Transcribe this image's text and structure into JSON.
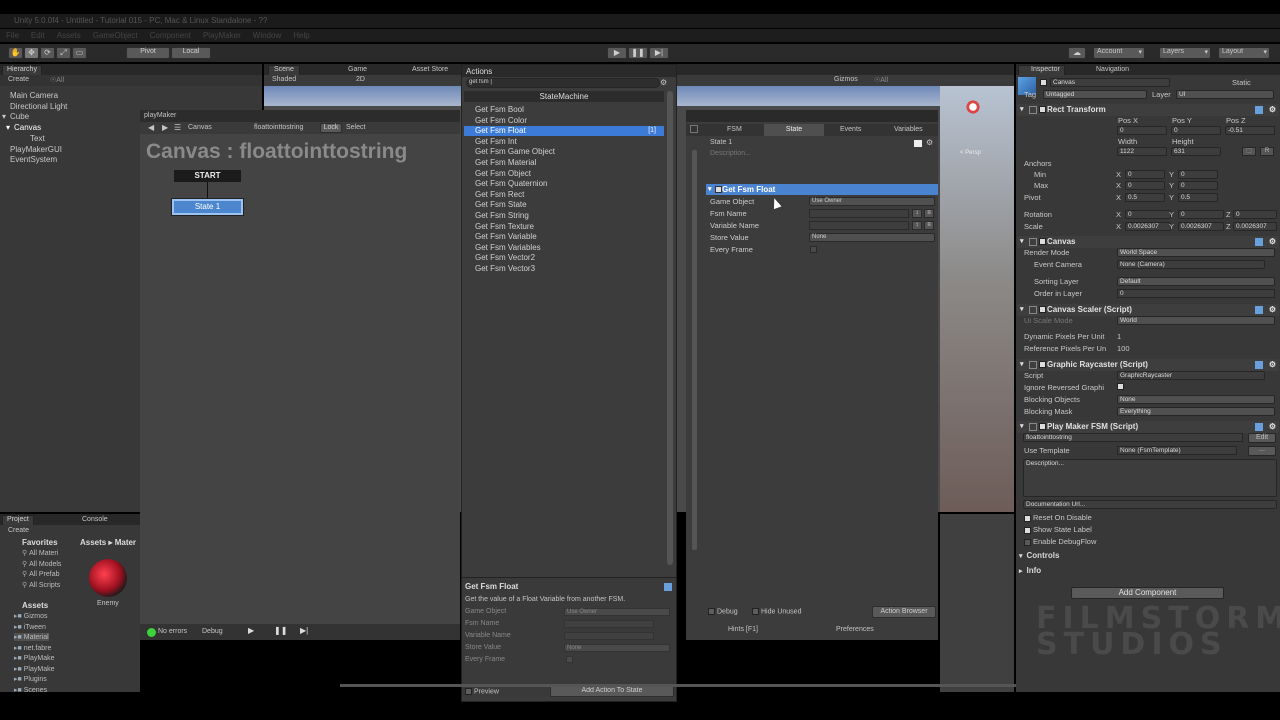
{
  "window_title": "Unity 5.0.0f4 - Untitled - Tutorial 015 - PC, Mac & Linux Standalone - ??",
  "menu": [
    "File",
    "Edit",
    "Assets",
    "GameObject",
    "Component",
    "PlayMaker",
    "Window",
    "Help"
  ],
  "toolbar": {
    "pivot": "Pivot",
    "local": "Local",
    "account": "Account",
    "layers": "Layers",
    "layout": "Layout"
  },
  "hierarchy": {
    "tab": "Hierarchy",
    "create": "Create",
    "search": "☉All",
    "items": [
      "Main Camera",
      "Directional Light",
      "Cube",
      "Canvas",
      "Text",
      "PlayMakerGUI",
      "EventSystem"
    ]
  },
  "scene": {
    "tabs": [
      "Scene",
      "Game",
      "Asset Store"
    ],
    "shaded": "Shaded",
    "mode2d": "2D",
    "gizmos": "Gizmos",
    "search": "☉All",
    "persp": "< Persp"
  },
  "playmaker": {
    "tab": "playMaker",
    "object": "Canvas",
    "fsm": "floattointtostring",
    "lock": "Lock",
    "select": "Select",
    "title": "Canvas : floattointtostring",
    "start": "START",
    "state": "State 1",
    "status": "No errors",
    "debug": "Debug"
  },
  "actions": {
    "title": "Actions",
    "search": "get fsm |",
    "category": "StateMachine",
    "items": [
      "Get Fsm Bool",
      "Get Fsm Color",
      "Get Fsm Float",
      "Get Fsm Int",
      "Get Fsm Game Object",
      "Get Fsm Material",
      "Get Fsm Object",
      "Get Fsm Quaternion",
      "Get Fsm Rect",
      "Get Fsm State",
      "Get Fsm String",
      "Get Fsm Texture",
      "Get Fsm Variable",
      "Get Fsm Variables",
      "Get Fsm Vector2",
      "Get Fsm Vector3"
    ],
    "selected_count": "[1]",
    "preview_title": "Get Fsm Float",
    "preview_desc": "Get the value of a Float Variable from another FSM.",
    "preview_fields": [
      "Game Object",
      "Fsm Name",
      "Variable Name",
      "Store Value",
      "Every Frame"
    ],
    "use_owner": "Use Owner",
    "none": "None",
    "preview": "Preview",
    "add": "Add Action To State"
  },
  "state_panel": {
    "tabs": [
      "FSM",
      "State",
      "Events",
      "Variables"
    ],
    "state_name": "State 1",
    "desc": "Description...",
    "action": "Get Fsm Float",
    "fields": [
      "Game Object",
      "Fsm Name",
      "Variable Name",
      "Store Value",
      "Every Frame"
    ],
    "use_owner": "Use Owner",
    "none": "None",
    "debug": "Debug",
    "hide_unused": "Hide Unused",
    "browser": "Action Browser",
    "hints": "Hints [F1]",
    "prefs": "Preferences"
  },
  "project": {
    "tabs": [
      "Project",
      "Console"
    ],
    "create": "Create",
    "favorites": "Favorites",
    "fav_items": [
      "All Materi",
      "All Models",
      "All Prefab",
      "All Scripts"
    ],
    "assets": "Assets",
    "asset_items": [
      "Gizmos",
      "iTween",
      "Material",
      "net.fabre",
      "PlayMake",
      "PlayMake",
      "Plugins",
      "Scenes"
    ],
    "breadcrumb": "Assets ▸ Mater",
    "thumb": "Enemy"
  },
  "inspector": {
    "tabs": [
      "Inspector",
      "Navigation"
    ],
    "name": "Canvas",
    "static": "Static",
    "tag": "Tag",
    "tag_val": "Untagged",
    "layer": "Layer",
    "layer_val": "UI",
    "rect": "Rect Transform",
    "posx": "Pos X",
    "posy": "Pos Y",
    "posz": "Pos Z",
    "pv": [
      "0",
      "0",
      "-0.51"
    ],
    "width": "Width",
    "height": "Height",
    "wv": "1122",
    "hv": "631",
    "anchors": "Anchors",
    "min": "Min",
    "max": "Max",
    "pivot": "Pivot",
    "rotation": "Rotation",
    "scale": "Scale",
    "minv": [
      "0",
      "0"
    ],
    "maxv": [
      "0",
      "0"
    ],
    "pivotv": [
      "0.5",
      "0.5"
    ],
    "rotv": [
      "0",
      "0",
      "0"
    ],
    "scalev": [
      "0.0026307",
      "0.0026307",
      "0.0026307"
    ],
    "canvas": "Canvas",
    "render_mode": "Render Mode",
    "render_val": "World Space",
    "event_cam": "Event Camera",
    "event_val": "None (Camera)",
    "sort_layer": "Sorting Layer",
    "sort_val": "Default",
    "order": "Order in Layer",
    "order_val": "0",
    "scaler": "Canvas Scaler (Script)",
    "ui_scale": "Ui Scale Mode",
    "ui_scale_val": "World",
    "dpu": "Dynamic Pixels Per Unit",
    "dpu_val": "1",
    "rpu": "Reference Pixels Per Un",
    "rpu_val": "100",
    "raycaster": "Graphic Raycaster (Script)",
    "script": "Script",
    "script_val": "GraphicRaycaster",
    "ignore": "Ignore Reversed Graphi",
    "blocking": "Blocking Objects",
    "blocking_val": "None",
    "mask": "Blocking Mask",
    "mask_val": "Everything",
    "pmfsm": "Play Maker FSM (Script)",
    "fsm_name": "floattointtostring",
    "edit": "Edit",
    "template": "Use Template",
    "template_val": "None (FsmTemplate)",
    "desc": "Description...",
    "doc": "Documentation Url...",
    "reset": "Reset On Disable",
    "show_label": "Show State Label",
    "debugflow": "Enable DebugFlow",
    "controls": "Controls",
    "info": "Info",
    "add_comp": "Add Component"
  },
  "watermark": [
    "FILMSTORM",
    "STUDIOS"
  ],
  "colors": {
    "selection": "#3d7bd8",
    "panel": "#383838",
    "graph": "#444444"
  }
}
